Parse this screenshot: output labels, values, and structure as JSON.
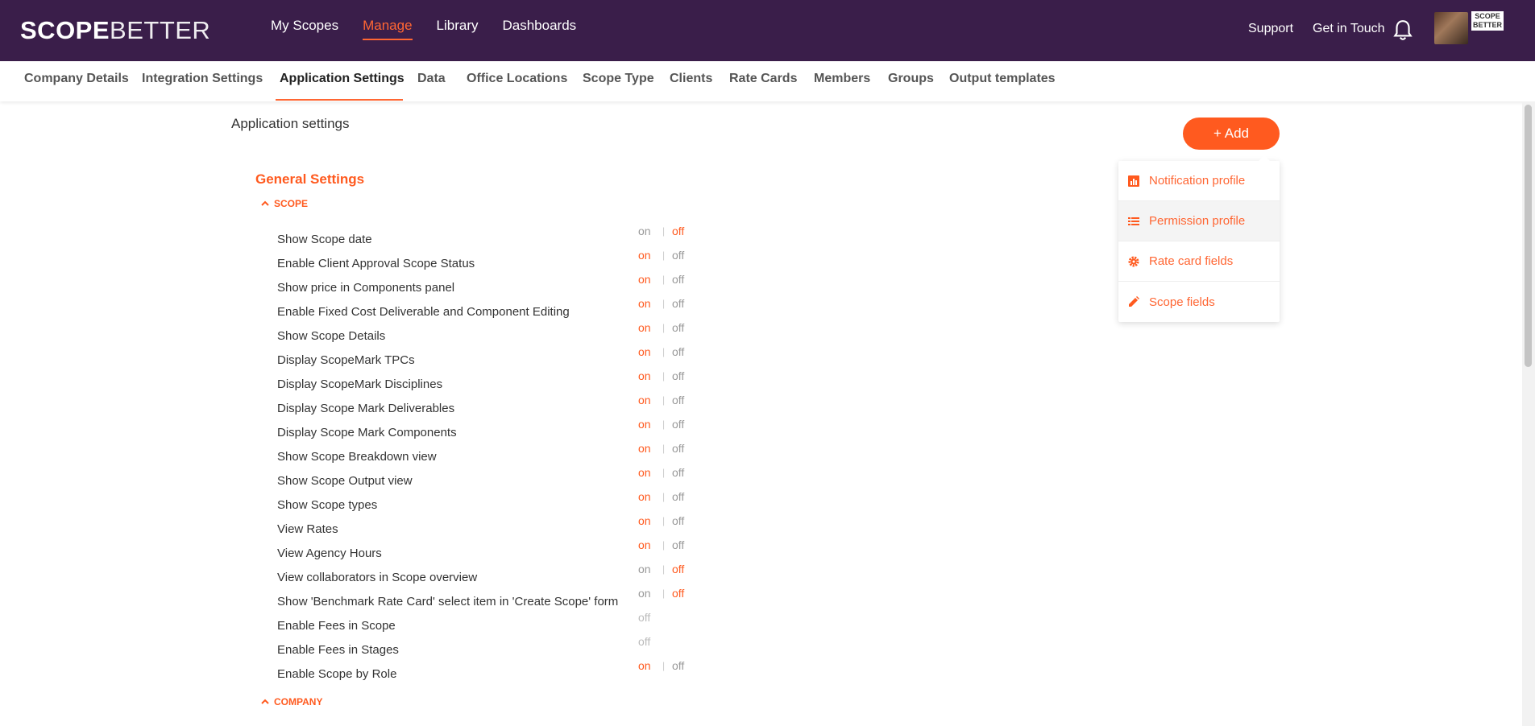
{
  "brand": {
    "logo_part1": "SCOPE",
    "logo_part2": "BETTER",
    "mini_logo": "SCOPE BETTER"
  },
  "main_nav": [
    {
      "label": "My Scopes",
      "active": false
    },
    {
      "label": "Manage",
      "active": true
    },
    {
      "label": "Library",
      "active": false
    },
    {
      "label": "Dashboards",
      "active": false
    }
  ],
  "top_links": {
    "support": "Support",
    "get_in_touch": "Get in Touch"
  },
  "sub_nav": [
    {
      "label": "Company Details",
      "active": false
    },
    {
      "label": "Integration Settings",
      "active": false
    },
    {
      "label": "Application Settings",
      "active": true
    },
    {
      "label": "Data",
      "active": false
    },
    {
      "label": "Office Locations",
      "active": false
    },
    {
      "label": "Scope Type",
      "active": false
    },
    {
      "label": "Clients",
      "active": false
    },
    {
      "label": "Rate Cards",
      "active": false
    },
    {
      "label": "Members",
      "active": false
    },
    {
      "label": "Groups",
      "active": false
    },
    {
      "label": "Output templates",
      "active": false
    }
  ],
  "page": {
    "title": "Application settings",
    "add_button": "+ Add",
    "section_title": "General Settings"
  },
  "add_menu": [
    {
      "label": "Notification profile",
      "icon": "bar-chart-icon"
    },
    {
      "label": "Permission profile",
      "icon": "list-icon"
    },
    {
      "label": "Rate card fields",
      "icon": "gear-icon"
    },
    {
      "label": "Scope fields",
      "icon": "pencil-icon"
    }
  ],
  "groups": {
    "scope": "SCOPE",
    "company": "COMPANY"
  },
  "toggle_labels": {
    "on": "on",
    "sep": "|",
    "off": "off"
  },
  "settings": [
    {
      "label": "Show Scope date",
      "state": "off",
      "mode": "toggle"
    },
    {
      "label": "Enable Client Approval Scope Status",
      "state": "on",
      "mode": "toggle"
    },
    {
      "label": "Show price in Components panel",
      "state": "on",
      "mode": "toggle"
    },
    {
      "label": "Enable Fixed Cost Deliverable and Component Editing",
      "state": "on",
      "mode": "toggle"
    },
    {
      "label": "Show Scope Details",
      "state": "on",
      "mode": "toggle"
    },
    {
      "label": "Display ScopeMark TPCs",
      "state": "on",
      "mode": "toggle"
    },
    {
      "label": "Display ScopeMark Disciplines",
      "state": "on",
      "mode": "toggle"
    },
    {
      "label": "Display Scope Mark Deliverables",
      "state": "on",
      "mode": "toggle"
    },
    {
      "label": "Display Scope Mark Components",
      "state": "on",
      "mode": "toggle"
    },
    {
      "label": "Show Scope Breakdown view",
      "state": "on",
      "mode": "toggle"
    },
    {
      "label": "Show Scope Output view",
      "state": "on",
      "mode": "toggle"
    },
    {
      "label": "Show Scope types",
      "state": "on",
      "mode": "toggle"
    },
    {
      "label": "View Rates",
      "state": "on",
      "mode": "toggle"
    },
    {
      "label": "View Agency Hours",
      "state": "on",
      "mode": "toggle"
    },
    {
      "label": "View collaborators in Scope overview",
      "state": "off",
      "mode": "toggle"
    },
    {
      "label": "Show 'Benchmark Rate Card' select item in 'Create Scope' form",
      "state": "off",
      "mode": "toggle"
    },
    {
      "label": "Enable Fees in Scope",
      "state": "off",
      "mode": "disabled"
    },
    {
      "label": "Enable Fees in Stages",
      "state": "off",
      "mode": "disabled"
    },
    {
      "label": "Enable Scope by Role",
      "state": "on",
      "mode": "toggle"
    }
  ],
  "colors": {
    "header_bg": "#3a1e4a",
    "accent": "#ff5a1f"
  }
}
